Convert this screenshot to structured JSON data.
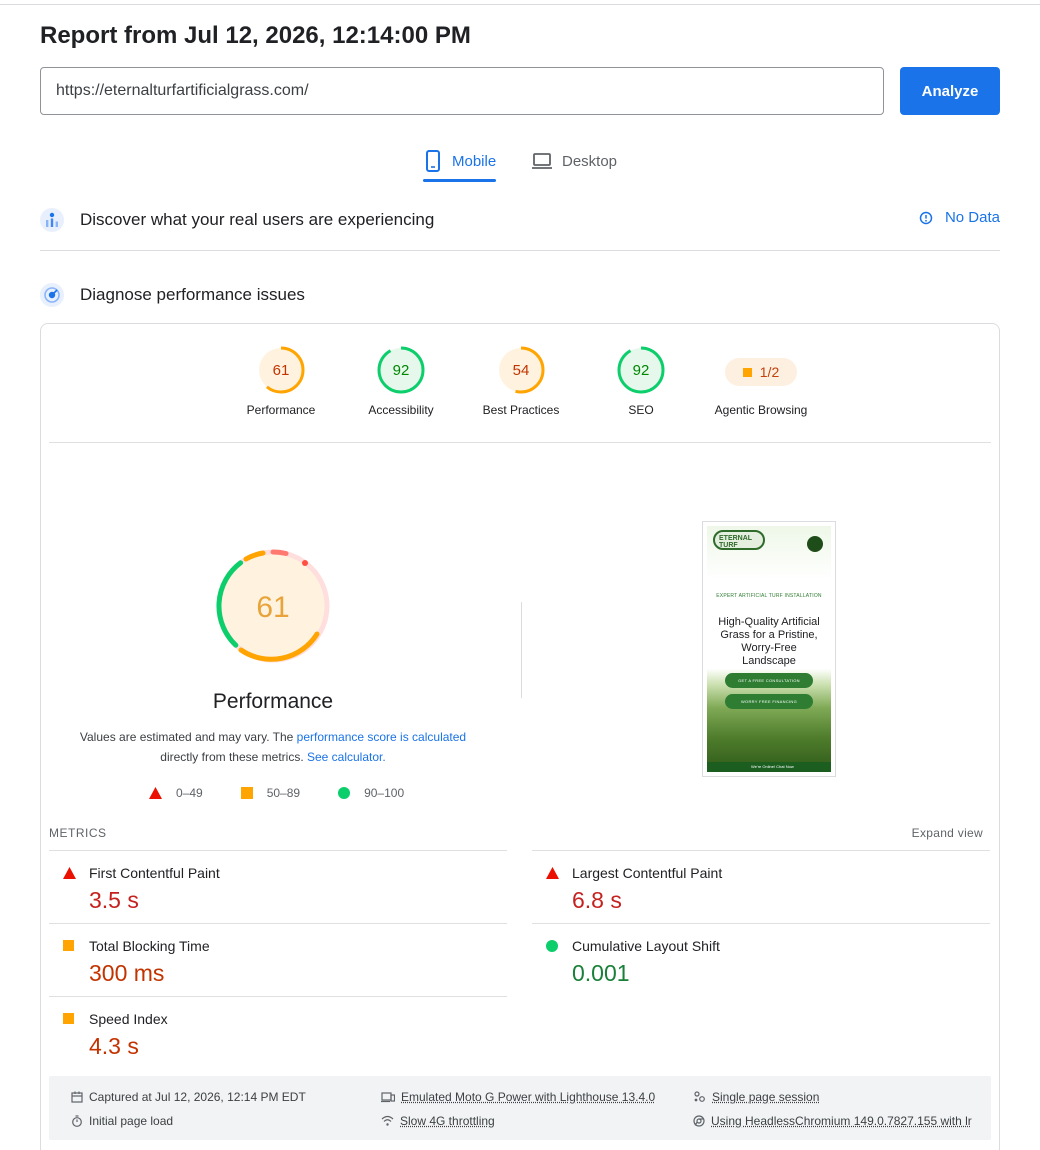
{
  "report": {
    "title": "Report from Jul 12, 2026, 12:14:00 PM",
    "url_value": "https://eternalturfartificialgrass.com/",
    "analyze_label": "Analyze"
  },
  "tabs": {
    "mobile": "Mobile",
    "desktop": "Desktop"
  },
  "sections": {
    "real_users": "Discover what your real users are experiencing",
    "no_data": "No Data",
    "diagnose": "Diagnose performance issues"
  },
  "categories": [
    {
      "label": "Performance",
      "score": "61",
      "status": "average"
    },
    {
      "label": "Accessibility",
      "score": "92",
      "status": "pass"
    },
    {
      "label": "Best Practices",
      "score": "54",
      "status": "average"
    },
    {
      "label": "SEO",
      "score": "92",
      "status": "pass"
    },
    {
      "label": "Agentic Browsing",
      "score": "1/2",
      "status": "average"
    }
  ],
  "performance": {
    "score": "61",
    "title": "Performance",
    "desc_before": "Values are estimated and may vary. The ",
    "desc_link1": "performance score is calculated",
    "desc_mid": " directly from these metrics. ",
    "desc_link2": "See calculator.",
    "legend": [
      "0–49",
      "50–89",
      "90–100"
    ]
  },
  "screenshot": {
    "logo_text": "ETERNAL TURF",
    "kicker": "EXPERT ARTIFICIAL TURF INSTALLATION",
    "headline": "High-Quality Artificial Grass for a Pristine, Worry-Free Landscape",
    "cta1": "GET A FREE CONSULTATION",
    "cta2": "WORRY FREE FINANCING",
    "chat": "We're Online! Chat Now"
  },
  "metrics": {
    "label": "METRICS",
    "expand": "Expand view",
    "items": [
      {
        "name": "First Contentful Paint",
        "value": "3.5 s",
        "status": "fail"
      },
      {
        "name": "Largest Contentful Paint",
        "value": "6.8 s",
        "status": "fail"
      },
      {
        "name": "Total Blocking Time",
        "value": "300 ms",
        "status": "average"
      },
      {
        "name": "Cumulative Layout Shift",
        "value": "0.001",
        "status": "pass"
      },
      {
        "name": "Speed Index",
        "value": "4.3 s",
        "status": "average"
      }
    ]
  },
  "footer": {
    "captured": "Captured at Jul 12, 2026, 12:14 PM EDT",
    "initial": "Initial page load",
    "emulated": "Emulated Moto G Power with Lighthouse 13.4.0",
    "throttling": "Slow 4G throttling",
    "session": "Single page session",
    "browser": "Using HeadlessChromium 149.0.7827.155 with lr"
  },
  "colors": {
    "accent": "#1a73e8",
    "pass": "#0cce6b",
    "average": "#ffa400",
    "fail": "#ff4e42"
  }
}
